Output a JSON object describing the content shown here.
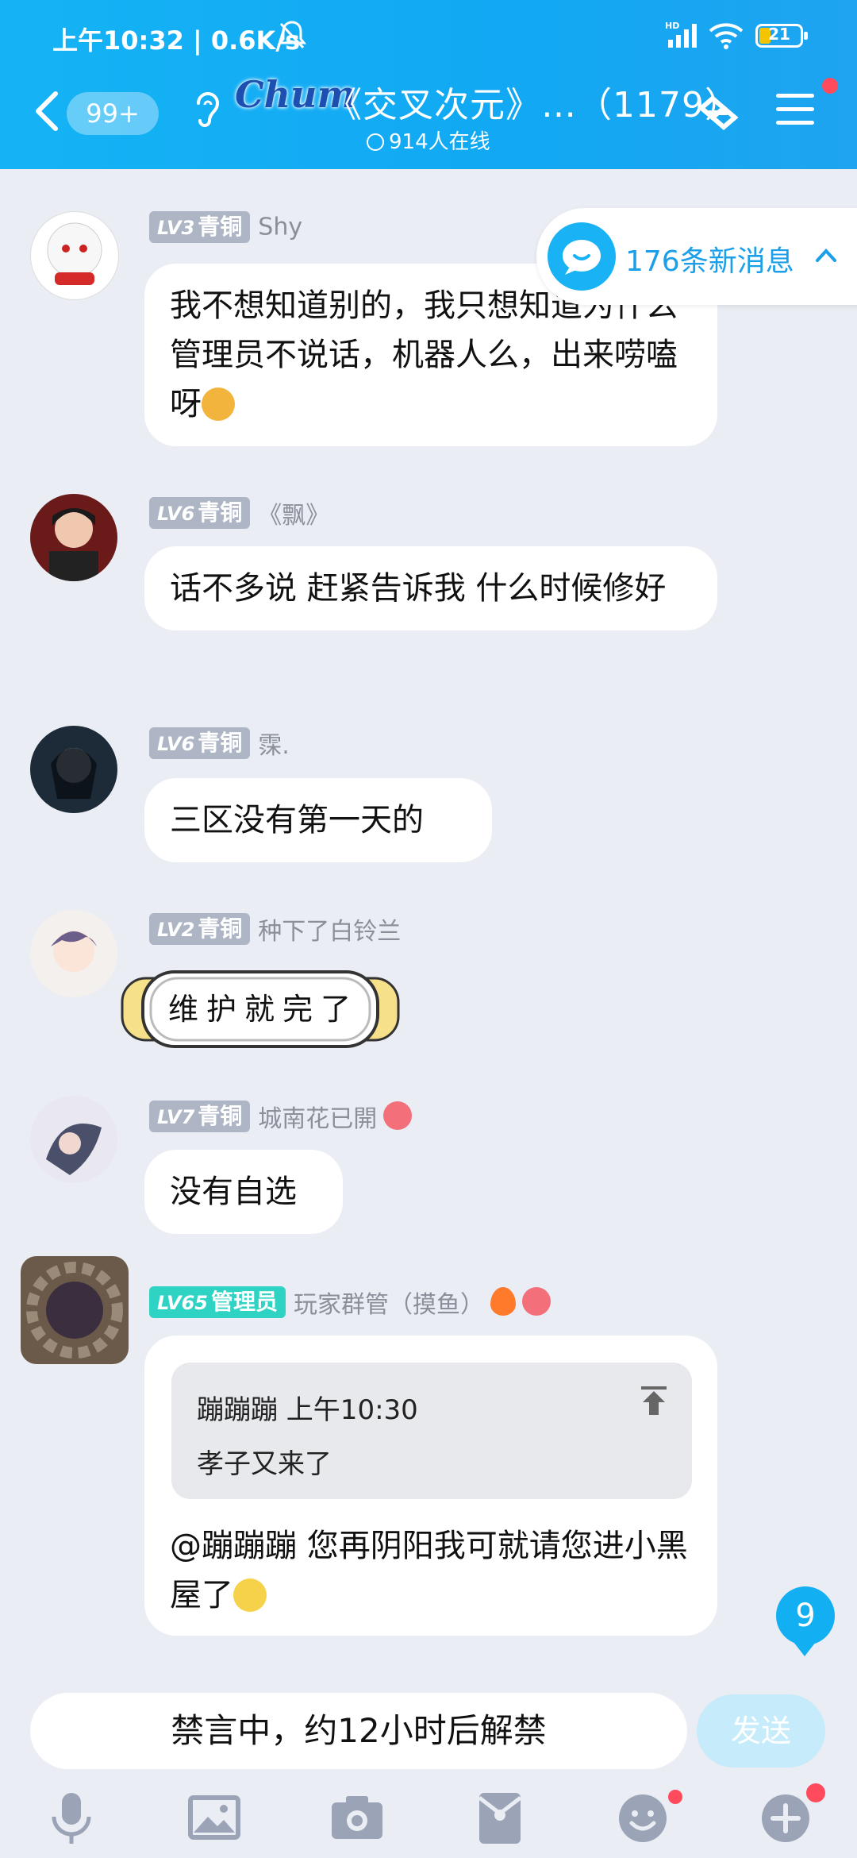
{
  "status_bar": {
    "time": "上午10:32 | 0.6K/s",
    "battery": "21",
    "network": "HD"
  },
  "header": {
    "unread_count": "99+",
    "logo_text": "Chum",
    "title": "《交叉次元》…（1179）",
    "online": "914人在线"
  },
  "new_messages": {
    "label": "176条新消息"
  },
  "messages": [
    {
      "level": "LV3",
      "rank": "青铜",
      "nick": "Shy",
      "text": "我不想知道别的，我只想知道为什么管理员不说话，机器人么，出来唠嗑呀"
    },
    {
      "level": "LV6",
      "rank": "青铜",
      "nick": "《飘》",
      "text": "话不多说 赶紧告诉我 什么时候修好"
    },
    {
      "level": "LV6",
      "rank": "青铜",
      "nick": "霂.",
      "text": "三区没有第一天的"
    },
    {
      "level": "LV2",
      "rank": "青铜",
      "nick": "种下了白铃兰",
      "sticker_text": "维护就完了"
    },
    {
      "level": "LV7",
      "rank": "青铜",
      "nick": "城南花已開",
      "text": "没有自选"
    },
    {
      "level": "LV65",
      "rank": "管理员",
      "nick": "玩家群管（摸鱼）",
      "quote_author": "蹦蹦蹦 上午10:30",
      "quote_text": "孝子又来了",
      "text": "@蹦蹦蹦 您再阴阳我可就请您进小黑屋了"
    }
  ],
  "unread_badge": "9",
  "input": {
    "muted_text": "禁言中，约12小时后解禁",
    "send_label": "发送"
  },
  "toolbar": [
    "microphone-icon",
    "image-icon",
    "camera-icon",
    "red-packet-icon",
    "emoji-icon",
    "plus-icon"
  ],
  "colors": {
    "header": "#15b3f5",
    "background": "#eaedf4",
    "accent": "#12b0f2",
    "admin_badge": "#2ed3c3",
    "level_badge": "#aeb6c6"
  }
}
